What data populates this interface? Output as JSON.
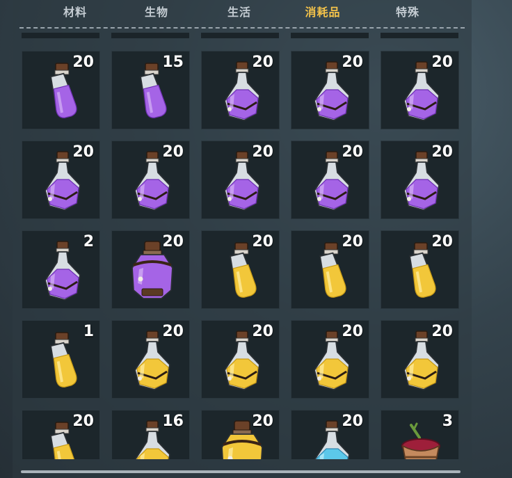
{
  "tabs": [
    {
      "label": "材料",
      "active": false
    },
    {
      "label": "生物",
      "active": false
    },
    {
      "label": "生活",
      "active": false
    },
    {
      "label": "消耗品",
      "active": true
    },
    {
      "label": "特殊",
      "active": false
    }
  ],
  "colors": {
    "active_tab": "#f3c24a",
    "tab": "#c4ccd2",
    "slot": "#1c262b"
  },
  "inventory": [
    {
      "icon": "purple-potion-vial-icon",
      "count": "20"
    },
    {
      "icon": "purple-potion-vial-icon",
      "count": "15"
    },
    {
      "icon": "purple-potion-flask-icon",
      "count": "20"
    },
    {
      "icon": "purple-potion-flask-icon",
      "count": "20"
    },
    {
      "icon": "purple-potion-flask-icon",
      "count": "20"
    },
    {
      "icon": "purple-potion-flask-icon",
      "count": "20"
    },
    {
      "icon": "purple-potion-flask-icon",
      "count": "20"
    },
    {
      "icon": "purple-potion-flask-icon",
      "count": "20"
    },
    {
      "icon": "purple-potion-flask-icon",
      "count": "20"
    },
    {
      "icon": "purple-potion-flask-icon",
      "count": "20"
    },
    {
      "icon": "purple-potion-flask-icon",
      "count": "2"
    },
    {
      "icon": "large-purple-potion-icon",
      "count": "20"
    },
    {
      "icon": "yellow-potion-vial-icon",
      "count": "20"
    },
    {
      "icon": "yellow-potion-vial-icon",
      "count": "20"
    },
    {
      "icon": "yellow-potion-vial-icon",
      "count": "20"
    },
    {
      "icon": "yellow-potion-vial-icon",
      "count": "1"
    },
    {
      "icon": "yellow-potion-flask-icon",
      "count": "20"
    },
    {
      "icon": "yellow-potion-flask-icon",
      "count": "20"
    },
    {
      "icon": "yellow-potion-flask-icon",
      "count": "20"
    },
    {
      "icon": "yellow-potion-flask-icon",
      "count": "20"
    },
    {
      "icon": "yellow-potion-vial-icon",
      "count": "20"
    },
    {
      "icon": "yellow-potion-flask-icon",
      "count": "16"
    },
    {
      "icon": "large-yellow-potion-icon",
      "count": "20"
    },
    {
      "icon": "blue-potion-flask-icon",
      "count": "20"
    },
    {
      "icon": "berry-bucket-icon",
      "count": "3"
    }
  ]
}
